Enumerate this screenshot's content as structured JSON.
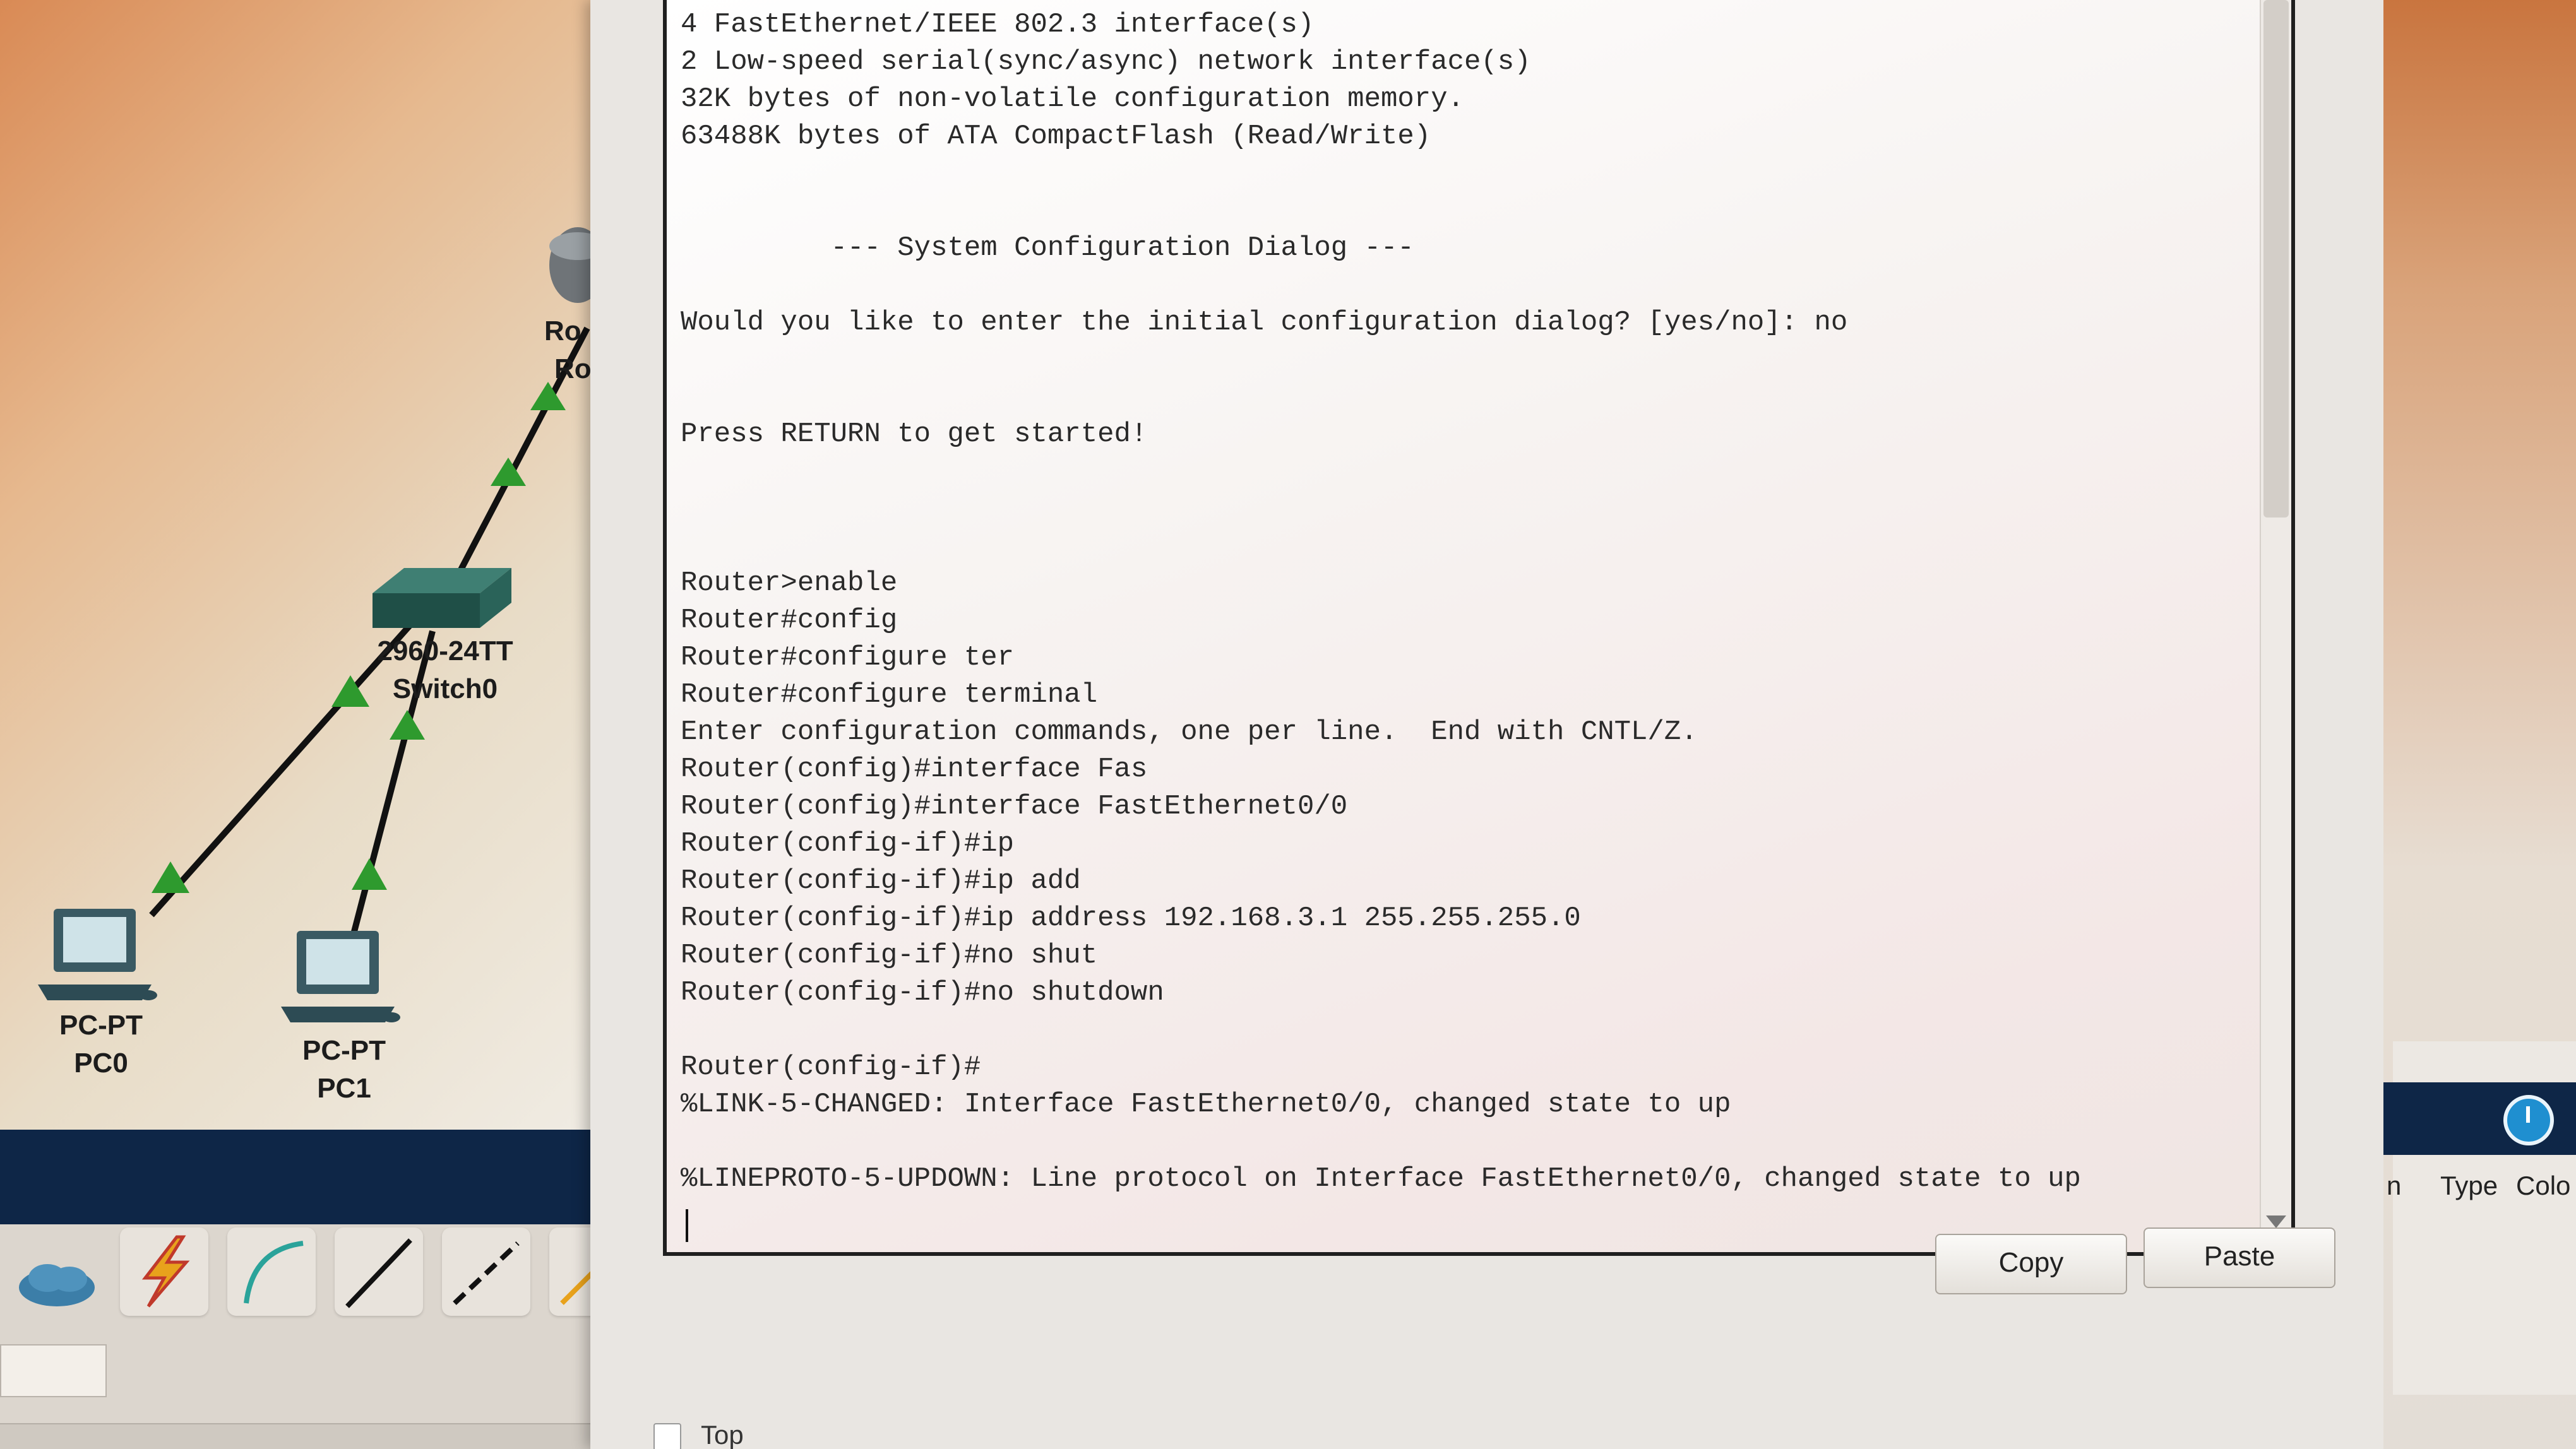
{
  "topology": {
    "router_label_partial": "Ro",
    "router_label_partial2": "Ro",
    "switch": {
      "model": "2960-24TT",
      "name": "Switch0"
    },
    "pc0": {
      "type": "PC-PT",
      "name": "PC0"
    },
    "pc1": {
      "type": "PC-PT",
      "name": "PC1"
    }
  },
  "tools": [
    "cloud-icon",
    "lightning-connection-icon",
    "console-cable-icon",
    "straight-through-cable-icon",
    "crossover-cable-icon",
    "fiber-cable-icon"
  ],
  "terminal": {
    "lines": [
      "4 FastEthernet/IEEE 802.3 interface(s)",
      "2 Low-speed serial(sync/async) network interface(s)",
      "32K bytes of non-volatile configuration memory.",
      "63488K bytes of ATA CompactFlash (Read/Write)",
      "",
      "",
      "         --- System Configuration Dialog ---",
      "",
      "Would you like to enter the initial configuration dialog? [yes/no]: no",
      "",
      "",
      "Press RETURN to get started!",
      "",
      "",
      "",
      "Router>enable",
      "Router#config",
      "Router#configure ter",
      "Router#configure terminal",
      "Enter configuration commands, one per line.  End with CNTL/Z.",
      "Router(config)#interface Fas",
      "Router(config)#interface FastEthernet0/0",
      "Router(config-if)#ip",
      "Router(config-if)#ip add",
      "Router(config-if)#ip address 192.168.3.1 255.255.255.0",
      "Router(config-if)#no shut",
      "Router(config-if)#no shutdown",
      "",
      "Router(config-if)#",
      "%LINK-5-CHANGED: Interface FastEthernet0/0, changed state to up",
      "",
      "%LINEPROTO-5-UPDOWN: Line protocol on Interface FastEthernet0/0, changed state to up"
    ]
  },
  "buttons": {
    "copy": "Copy",
    "paste": "Paste"
  },
  "top_option": {
    "label": "Top"
  },
  "right_panel": {
    "headers": [
      "n",
      "Type",
      "Colo"
    ]
  },
  "colors": {
    "bar": "#0e2647",
    "link_up": "#2e9a2e",
    "terminal_text": "#2a2a2a"
  }
}
